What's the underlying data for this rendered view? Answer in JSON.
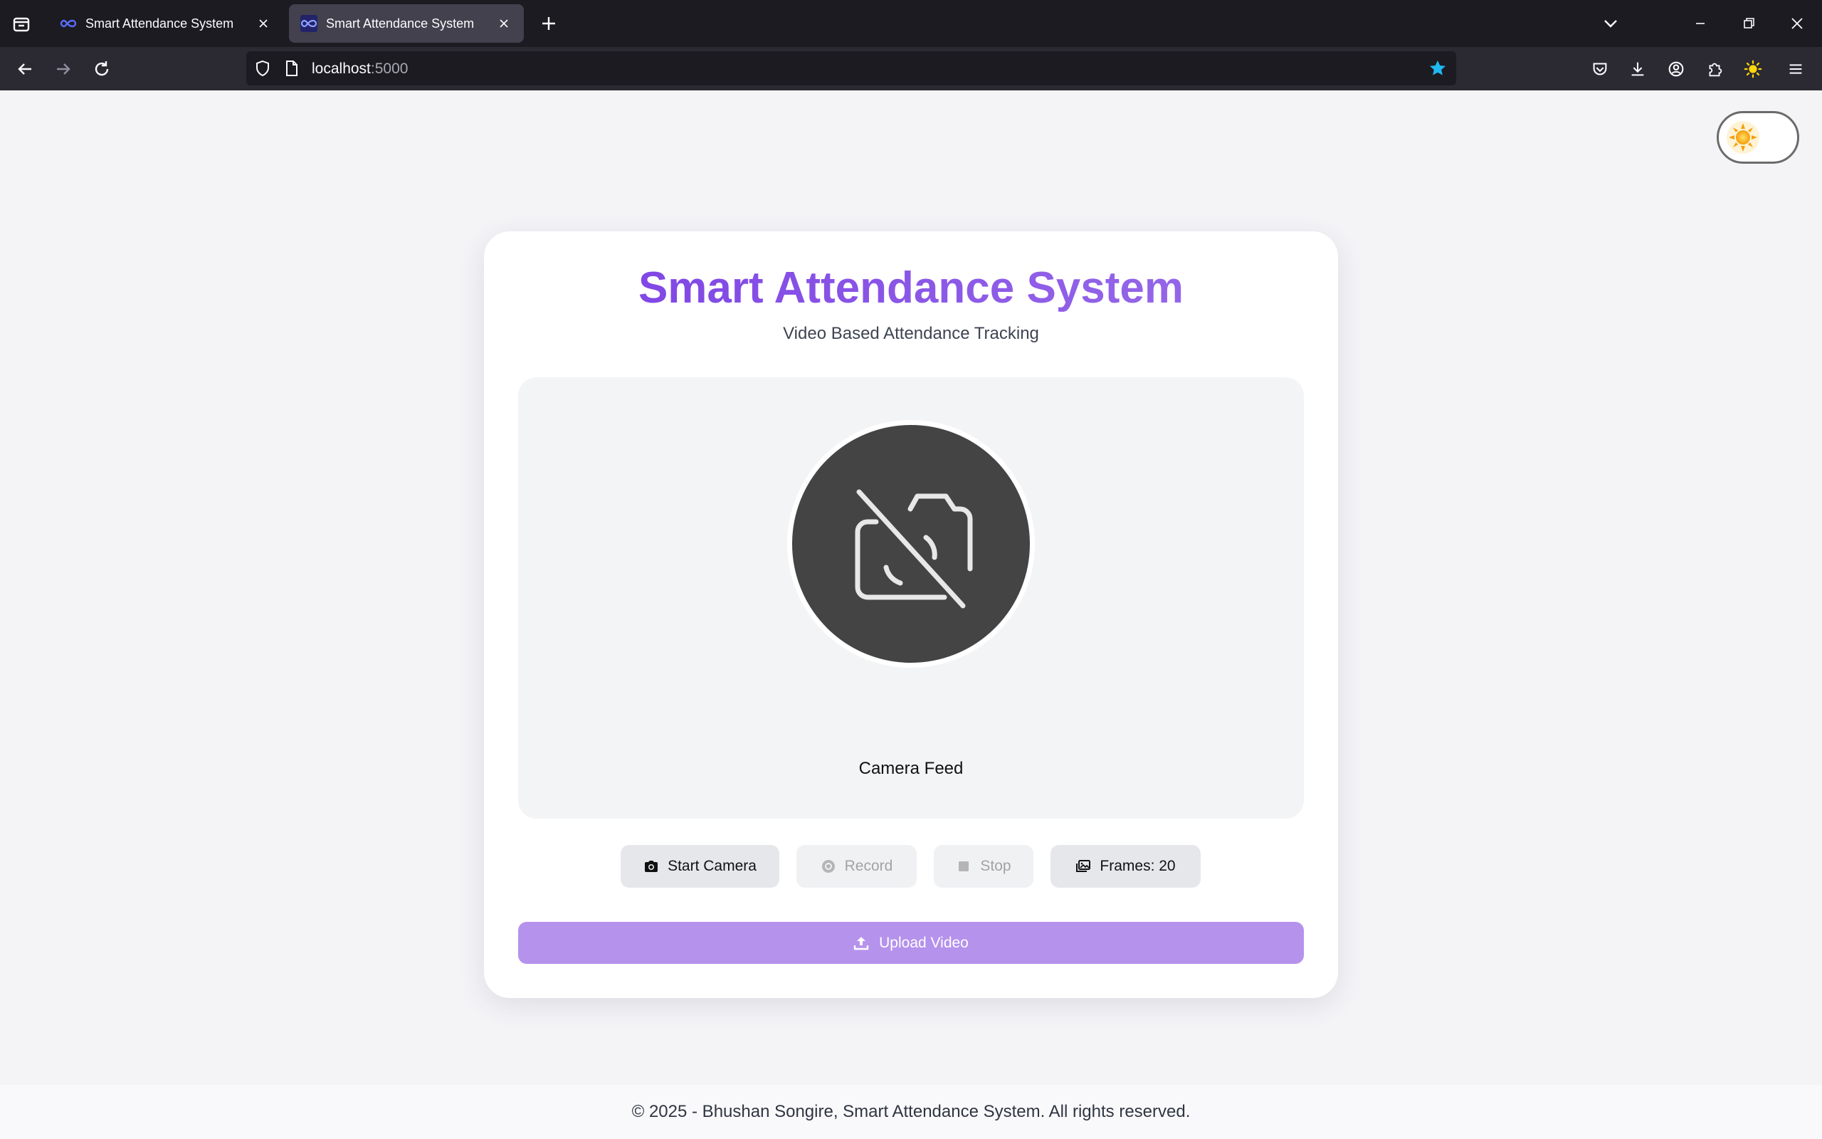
{
  "browser": {
    "tabs": [
      {
        "title": "Smart Attendance System",
        "active": false
      },
      {
        "title": "Smart Attendance System",
        "active": true
      }
    ],
    "url_host": "localhost",
    "url_port": ":5000"
  },
  "header": {
    "title": "Smart Attendance System",
    "subtitle": "Video Based Attendance Tracking"
  },
  "feed": {
    "label": "Camera Feed",
    "icon": "camera-off-icon"
  },
  "controls": {
    "start_camera": "Start Camera",
    "record": "Record",
    "stop": "Stop",
    "frames": "Frames: 20"
  },
  "upload": {
    "label": "Upload Video"
  },
  "footer": {
    "text": "© 2025 - Bhushan Songire, Smart Attendance System. All rights reserved."
  },
  "colors": {
    "accent": "#7b3fe4",
    "upload_button": "#b592ec",
    "page_background": "#f4f4f7"
  }
}
